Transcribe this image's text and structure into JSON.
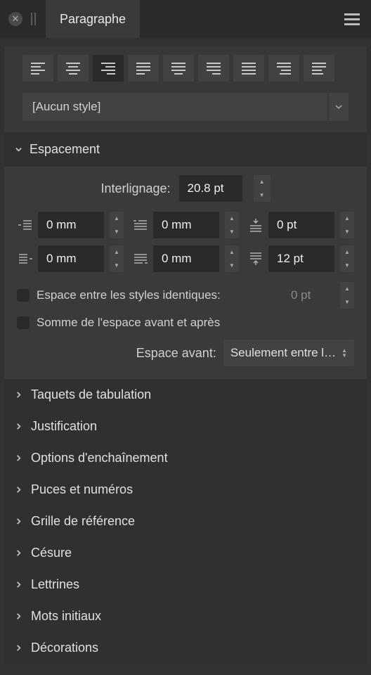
{
  "header": {
    "tab_title": "Paragraphe"
  },
  "style": {
    "selected": "[Aucun style]"
  },
  "spacing": {
    "title": "Espacement",
    "leading_label": "Interlignage:",
    "leading_value": "20.8 pt",
    "left_indent": "0 mm",
    "first_line": "0 mm",
    "space_before": "0 pt",
    "right_indent": "0 mm",
    "last_line": "0 mm",
    "space_after": "12 pt",
    "same_style_label": "Espace entre les styles identiques:",
    "same_style_value": "0 pt",
    "sum_label": "Somme de l'espace avant et après",
    "before_label": "Espace avant:",
    "before_value": "Seulement entre l…"
  },
  "sections": {
    "tabs": "Taquets de tabulation",
    "justification": "Justification",
    "flow": "Options d'enchaînement",
    "bullets": "Puces et numéros",
    "baseline": "Grille de référence",
    "hyphen": "Césure",
    "dropcaps": "Lettrines",
    "initial": "Mots initiaux",
    "deco": "Décorations"
  }
}
